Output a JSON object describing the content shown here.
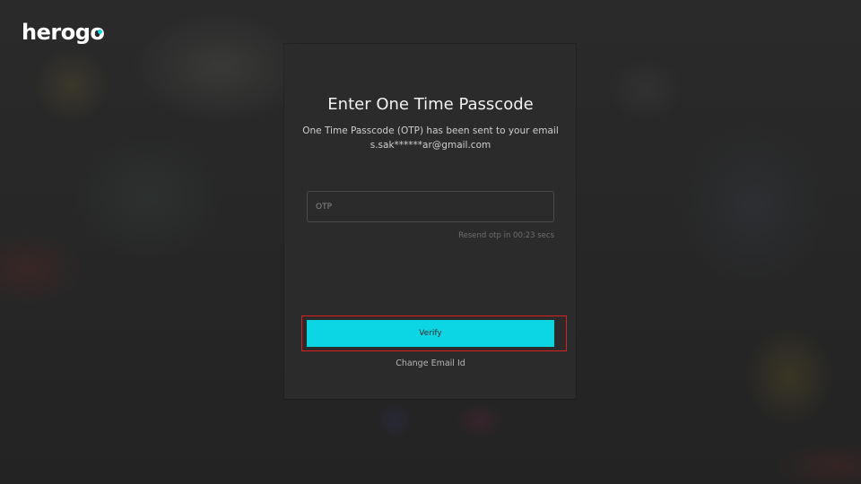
{
  "brand": {
    "logo_text_main": "herog",
    "logo_text_end": "o",
    "accent_color": "#0cd6e3"
  },
  "otp_dialog": {
    "title": "Enter One Time Passcode",
    "subtitle_line1": "One Time Passcode (OTP) has been sent to your email",
    "subtitle_line2": "s.sak******ar@gmail.com",
    "otp_input": {
      "placeholder": "OTP",
      "value": ""
    },
    "resend_text": "Resend otp in 00:23 secs",
    "verify_label": "Verify",
    "change_email_label": "Change Email Id",
    "highlight_color": "#e02020"
  }
}
